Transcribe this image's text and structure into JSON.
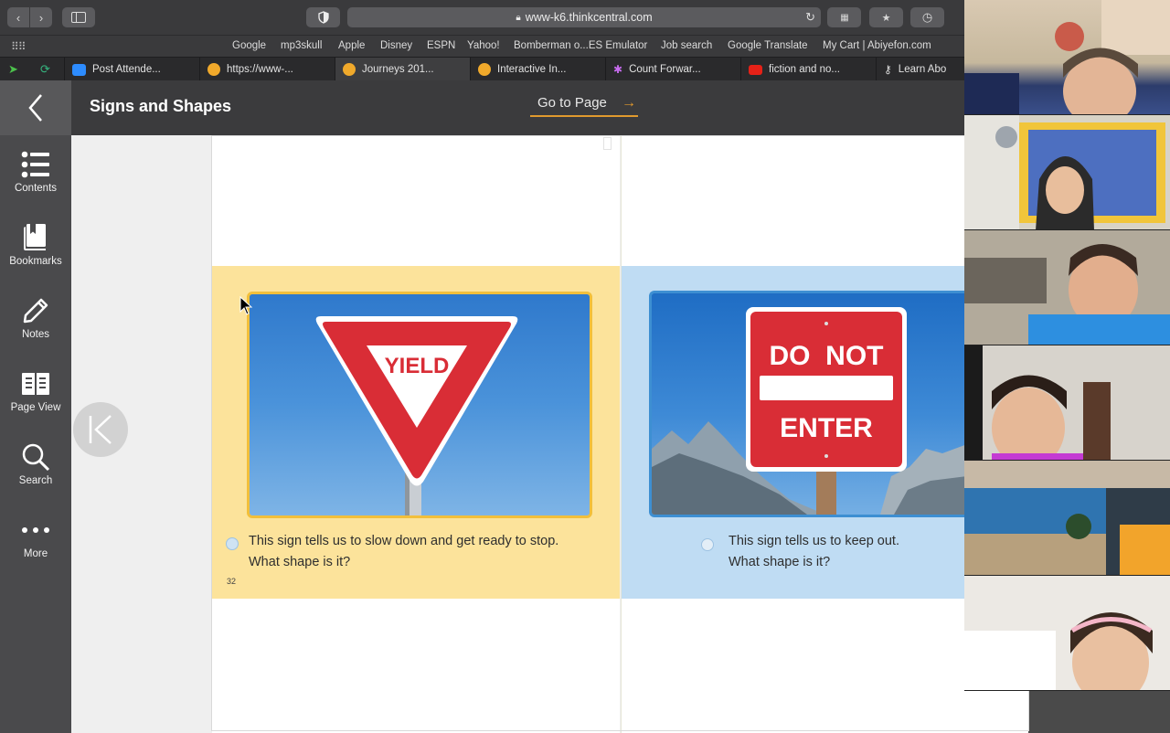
{
  "browser": {
    "url": "www-k6.thinkcentral.com",
    "favorites": [
      "Google",
      "mp3skull",
      "Apple",
      "Disney",
      "ESPN",
      "Yahoo!",
      "Bomberman o...ES Emulator",
      "Job search",
      "Google Translate",
      "My Cart | Abiyefon.com"
    ],
    "tabs": [
      {
        "label": "Post Attende...",
        "icon": "zoom-icon",
        "color": "#2d8cff"
      },
      {
        "label": "https://www-...",
        "icon": "orange-circle-icon",
        "color": "#f0a92b"
      },
      {
        "label": "Journeys 201...",
        "icon": "orange-circle-icon",
        "color": "#f0a92b"
      },
      {
        "label": "Interactive In...",
        "icon": "orange-circle-icon",
        "color": "#f0a92b"
      },
      {
        "label": "Count Forwar...",
        "icon": "puzzle-icon",
        "color": "#8a5cf6"
      },
      {
        "label": "fiction and no...",
        "icon": "youtube-icon",
        "color": "#e62117"
      },
      {
        "label": "Learn Abo",
        "icon": "key-icon",
        "color": "#dddddd"
      }
    ]
  },
  "app": {
    "title": "Signs and Shapes",
    "goto_label": "Go to Page",
    "rail": [
      {
        "label": "Contents",
        "icon": "list-icon"
      },
      {
        "label": "Bookmarks",
        "icon": "bookmark-book-icon"
      },
      {
        "label": "Notes",
        "icon": "pencil-icon"
      },
      {
        "label": "Page View",
        "icon": "open-book-icon"
      },
      {
        "label": "Search",
        "icon": "search-icon"
      },
      {
        "label": "More",
        "icon": "more-dots-icon"
      }
    ]
  },
  "book": {
    "left": {
      "sign_text": "YIELD",
      "caption_line1": "This sign tells us to slow down and get ready to stop.",
      "caption_line2": "What shape is it?",
      "page_number": "32"
    },
    "right": {
      "sign_line1": "DO  NOT",
      "sign_line2": "ENTER",
      "caption_line1": "This sign tells us to keep out.",
      "caption_line2": "What shape is it?"
    }
  },
  "colors": {
    "accent_orange": "#e39a2c",
    "band_yellow": "#fce39b",
    "band_blue": "#bfdcf3",
    "sign_red": "#d92d36"
  }
}
